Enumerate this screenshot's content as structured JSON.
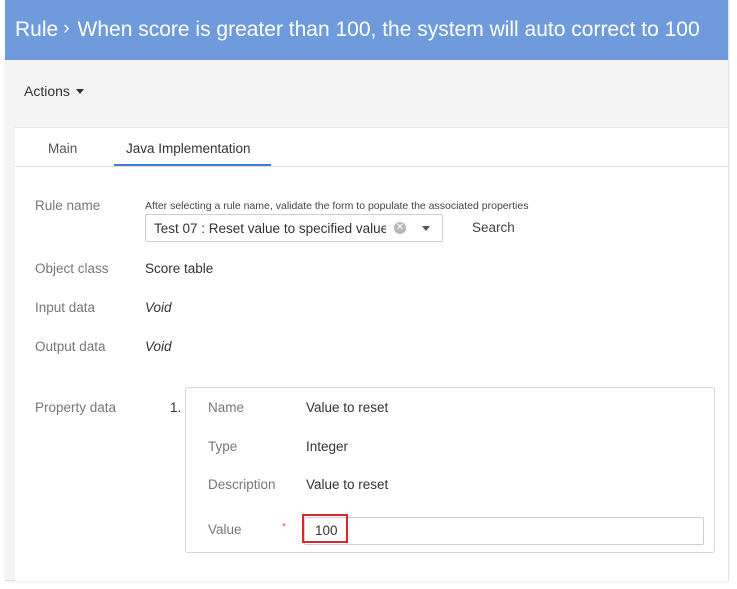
{
  "header": {
    "prefix": "Rule",
    "chevron": "›",
    "title": "When score is greater than 100, the system will auto correct to 100",
    "color": "#6f9bdc"
  },
  "toolbar": {
    "actions_label": "Actions"
  },
  "tabs": [
    {
      "label": "Main",
      "active": false
    },
    {
      "label": "Java Implementation",
      "active": true
    }
  ],
  "form": {
    "rule_name": {
      "label": "Rule name",
      "hint": "After selecting a rule name, validate the form to populate the associated properties",
      "selected": "Test 07 : Reset value to specified value",
      "search_label": "Search"
    },
    "object_class": {
      "label": "Object class",
      "value": "Score table"
    },
    "input_data": {
      "label": "Input data",
      "value": "Void"
    },
    "output_data": {
      "label": "Output data",
      "value": "Void"
    },
    "property_data": {
      "label": "Property data",
      "items": [
        {
          "number": "1.",
          "name_label": "Name",
          "name": "Value to reset",
          "type_label": "Type",
          "type": "Integer",
          "description_label": "Description",
          "description": "Value to reset",
          "value_label": "Value",
          "required_mark": "*",
          "value": "100"
        }
      ]
    }
  },
  "colors": {
    "accent": "#3d7fd6",
    "highlight": "#d62a2a",
    "required": "#e05050"
  },
  "icons": {
    "clear": "circle-x-icon",
    "dropdown": "caret-down-icon"
  }
}
